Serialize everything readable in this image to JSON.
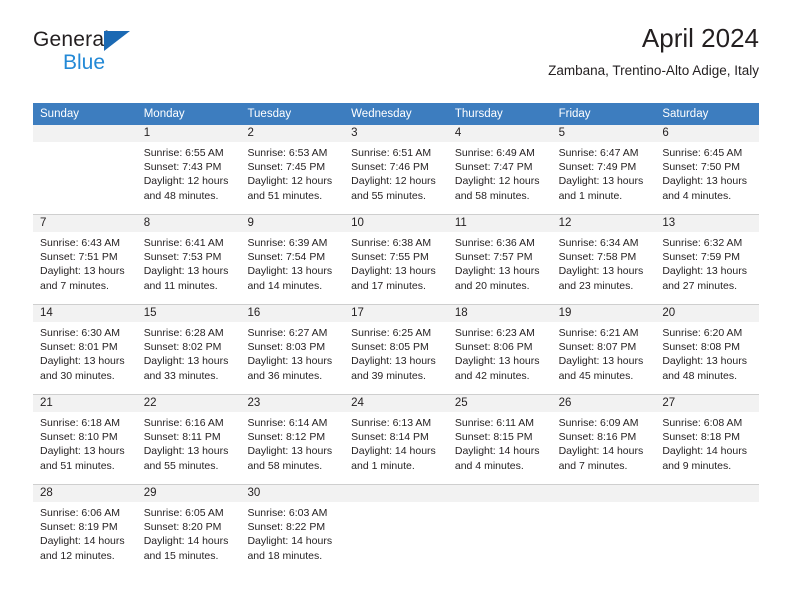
{
  "logo": {
    "word_one": "General",
    "word_two": "Blue",
    "triangle_color": "#1b69b3",
    "blue_text_color": "#2389d6"
  },
  "header": {
    "title": "April 2024",
    "subtitle": "Zambana, Trentino-Alto Adige, Italy"
  },
  "theme": {
    "header_bg": "#3d7dbf",
    "header_text": "#ffffff",
    "daynum_bg": "#f2f2f2",
    "body_bg": "#ffffff",
    "grid_line": "#cfcfcf",
    "text": "#231f20"
  },
  "calendar": {
    "weekday_headers": [
      "Sunday",
      "Monday",
      "Tuesday",
      "Wednesday",
      "Thursday",
      "Friday",
      "Saturday"
    ],
    "weeks": [
      {
        "numbers": [
          "",
          "1",
          "2",
          "3",
          "4",
          "5",
          "6"
        ],
        "days": [
          {
            "empty": true,
            "sunrise": "",
            "sunset": "",
            "daylight_a": "",
            "daylight_b": ""
          },
          {
            "empty": false,
            "sunrise": "Sunrise: 6:55 AM",
            "sunset": "Sunset: 7:43 PM",
            "daylight_a": "Daylight: 12 hours",
            "daylight_b": "and 48 minutes."
          },
          {
            "empty": false,
            "sunrise": "Sunrise: 6:53 AM",
            "sunset": "Sunset: 7:45 PM",
            "daylight_a": "Daylight: 12 hours",
            "daylight_b": "and 51 minutes."
          },
          {
            "empty": false,
            "sunrise": "Sunrise: 6:51 AM",
            "sunset": "Sunset: 7:46 PM",
            "daylight_a": "Daylight: 12 hours",
            "daylight_b": "and 55 minutes."
          },
          {
            "empty": false,
            "sunrise": "Sunrise: 6:49 AM",
            "sunset": "Sunset: 7:47 PM",
            "daylight_a": "Daylight: 12 hours",
            "daylight_b": "and 58 minutes."
          },
          {
            "empty": false,
            "sunrise": "Sunrise: 6:47 AM",
            "sunset": "Sunset: 7:49 PM",
            "daylight_a": "Daylight: 13 hours",
            "daylight_b": "and 1 minute."
          },
          {
            "empty": false,
            "sunrise": "Sunrise: 6:45 AM",
            "sunset": "Sunset: 7:50 PM",
            "daylight_a": "Daylight: 13 hours",
            "daylight_b": "and 4 minutes."
          }
        ]
      },
      {
        "numbers": [
          "7",
          "8",
          "9",
          "10",
          "11",
          "12",
          "13"
        ],
        "days": [
          {
            "empty": false,
            "sunrise": "Sunrise: 6:43 AM",
            "sunset": "Sunset: 7:51 PM",
            "daylight_a": "Daylight: 13 hours",
            "daylight_b": "and 7 minutes."
          },
          {
            "empty": false,
            "sunrise": "Sunrise: 6:41 AM",
            "sunset": "Sunset: 7:53 PM",
            "daylight_a": "Daylight: 13 hours",
            "daylight_b": "and 11 minutes."
          },
          {
            "empty": false,
            "sunrise": "Sunrise: 6:39 AM",
            "sunset": "Sunset: 7:54 PM",
            "daylight_a": "Daylight: 13 hours",
            "daylight_b": "and 14 minutes."
          },
          {
            "empty": false,
            "sunrise": "Sunrise: 6:38 AM",
            "sunset": "Sunset: 7:55 PM",
            "daylight_a": "Daylight: 13 hours",
            "daylight_b": "and 17 minutes."
          },
          {
            "empty": false,
            "sunrise": "Sunrise: 6:36 AM",
            "sunset": "Sunset: 7:57 PM",
            "daylight_a": "Daylight: 13 hours",
            "daylight_b": "and 20 minutes."
          },
          {
            "empty": false,
            "sunrise": "Sunrise: 6:34 AM",
            "sunset": "Sunset: 7:58 PM",
            "daylight_a": "Daylight: 13 hours",
            "daylight_b": "and 23 minutes."
          },
          {
            "empty": false,
            "sunrise": "Sunrise: 6:32 AM",
            "sunset": "Sunset: 7:59 PM",
            "daylight_a": "Daylight: 13 hours",
            "daylight_b": "and 27 minutes."
          }
        ]
      },
      {
        "numbers": [
          "14",
          "15",
          "16",
          "17",
          "18",
          "19",
          "20"
        ],
        "days": [
          {
            "empty": false,
            "sunrise": "Sunrise: 6:30 AM",
            "sunset": "Sunset: 8:01 PM",
            "daylight_a": "Daylight: 13 hours",
            "daylight_b": "and 30 minutes."
          },
          {
            "empty": false,
            "sunrise": "Sunrise: 6:28 AM",
            "sunset": "Sunset: 8:02 PM",
            "daylight_a": "Daylight: 13 hours",
            "daylight_b": "and 33 minutes."
          },
          {
            "empty": false,
            "sunrise": "Sunrise: 6:27 AM",
            "sunset": "Sunset: 8:03 PM",
            "daylight_a": "Daylight: 13 hours",
            "daylight_b": "and 36 minutes."
          },
          {
            "empty": false,
            "sunrise": "Sunrise: 6:25 AM",
            "sunset": "Sunset: 8:05 PM",
            "daylight_a": "Daylight: 13 hours",
            "daylight_b": "and 39 minutes."
          },
          {
            "empty": false,
            "sunrise": "Sunrise: 6:23 AM",
            "sunset": "Sunset: 8:06 PM",
            "daylight_a": "Daylight: 13 hours",
            "daylight_b": "and 42 minutes."
          },
          {
            "empty": false,
            "sunrise": "Sunrise: 6:21 AM",
            "sunset": "Sunset: 8:07 PM",
            "daylight_a": "Daylight: 13 hours",
            "daylight_b": "and 45 minutes."
          },
          {
            "empty": false,
            "sunrise": "Sunrise: 6:20 AM",
            "sunset": "Sunset: 8:08 PM",
            "daylight_a": "Daylight: 13 hours",
            "daylight_b": "and 48 minutes."
          }
        ]
      },
      {
        "numbers": [
          "21",
          "22",
          "23",
          "24",
          "25",
          "26",
          "27"
        ],
        "days": [
          {
            "empty": false,
            "sunrise": "Sunrise: 6:18 AM",
            "sunset": "Sunset: 8:10 PM",
            "daylight_a": "Daylight: 13 hours",
            "daylight_b": "and 51 minutes."
          },
          {
            "empty": false,
            "sunrise": "Sunrise: 6:16 AM",
            "sunset": "Sunset: 8:11 PM",
            "daylight_a": "Daylight: 13 hours",
            "daylight_b": "and 55 minutes."
          },
          {
            "empty": false,
            "sunrise": "Sunrise: 6:14 AM",
            "sunset": "Sunset: 8:12 PM",
            "daylight_a": "Daylight: 13 hours",
            "daylight_b": "and 58 minutes."
          },
          {
            "empty": false,
            "sunrise": "Sunrise: 6:13 AM",
            "sunset": "Sunset: 8:14 PM",
            "daylight_a": "Daylight: 14 hours",
            "daylight_b": "and 1 minute."
          },
          {
            "empty": false,
            "sunrise": "Sunrise: 6:11 AM",
            "sunset": "Sunset: 8:15 PM",
            "daylight_a": "Daylight: 14 hours",
            "daylight_b": "and 4 minutes."
          },
          {
            "empty": false,
            "sunrise": "Sunrise: 6:09 AM",
            "sunset": "Sunset: 8:16 PM",
            "daylight_a": "Daylight: 14 hours",
            "daylight_b": "and 7 minutes."
          },
          {
            "empty": false,
            "sunrise": "Sunrise: 6:08 AM",
            "sunset": "Sunset: 8:18 PM",
            "daylight_a": "Daylight: 14 hours",
            "daylight_b": "and 9 minutes."
          }
        ]
      },
      {
        "numbers": [
          "28",
          "29",
          "30",
          "",
          "",
          "",
          ""
        ],
        "days": [
          {
            "empty": false,
            "sunrise": "Sunrise: 6:06 AM",
            "sunset": "Sunset: 8:19 PM",
            "daylight_a": "Daylight: 14 hours",
            "daylight_b": "and 12 minutes."
          },
          {
            "empty": false,
            "sunrise": "Sunrise: 6:05 AM",
            "sunset": "Sunset: 8:20 PM",
            "daylight_a": "Daylight: 14 hours",
            "daylight_b": "and 15 minutes."
          },
          {
            "empty": false,
            "sunrise": "Sunrise: 6:03 AM",
            "sunset": "Sunset: 8:22 PM",
            "daylight_a": "Daylight: 14 hours",
            "daylight_b": "and 18 minutes."
          },
          {
            "empty": true,
            "sunrise": "",
            "sunset": "",
            "daylight_a": "",
            "daylight_b": ""
          },
          {
            "empty": true,
            "sunrise": "",
            "sunset": "",
            "daylight_a": "",
            "daylight_b": ""
          },
          {
            "empty": true,
            "sunrise": "",
            "sunset": "",
            "daylight_a": "",
            "daylight_b": ""
          },
          {
            "empty": true,
            "sunrise": "",
            "sunset": "",
            "daylight_a": "",
            "daylight_b": ""
          }
        ]
      }
    ]
  }
}
